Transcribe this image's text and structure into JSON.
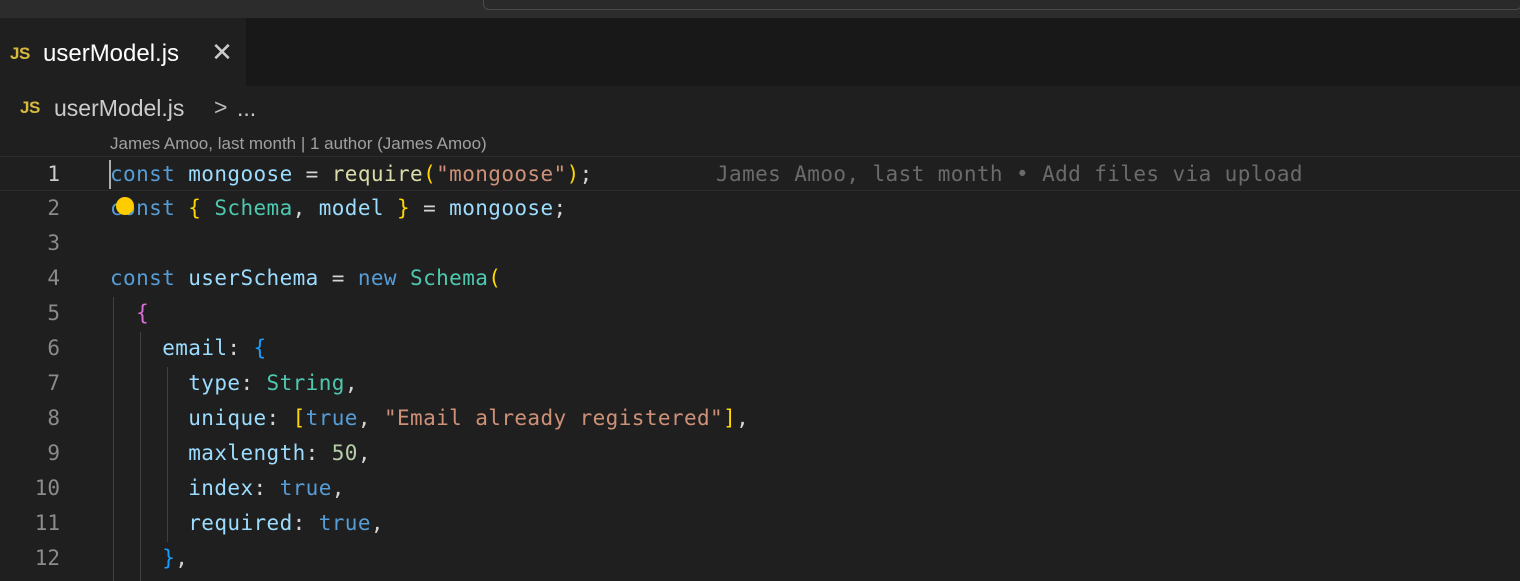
{
  "tab": {
    "badge": "JS",
    "label": "userModel.js",
    "close_icon": "close-icon"
  },
  "breadcrumb": {
    "badge": "JS",
    "file": "userModel.js",
    "separator": ">",
    "more": "..."
  },
  "codelens": "James Amoo, last month | 1 author (James Amoo)",
  "blame": "James Amoo, last month • Add files via upload",
  "line_numbers": [
    "1",
    "2",
    "3",
    "4",
    "5",
    "6",
    "7",
    "8",
    "9",
    "10",
    "11",
    "12"
  ],
  "code_lines": [
    "const mongoose = require(\"mongoose\");",
    "const { Schema, model } = mongoose;",
    "",
    "const userSchema = new Schema(",
    "  {",
    "    email: {",
    "      type: String,",
    "      unique: [true, \"Email already registered\"],",
    "      maxlength: 50,",
    "      index: true,",
    "      required: true,",
    "    },"
  ],
  "colors": {
    "background": "#1f1f1f",
    "keyword": "#569cd6",
    "variable": "#9cdcfe",
    "type": "#4ec9b0",
    "function": "#dcdcaa",
    "string": "#ce9178",
    "number": "#b5cea8",
    "js_badge": "#d7ba3d",
    "lightbulb": "#ffcc00"
  },
  "icons": {
    "lightbulb": "lightbulb-icon",
    "chevron": "chevron-right-icon"
  }
}
